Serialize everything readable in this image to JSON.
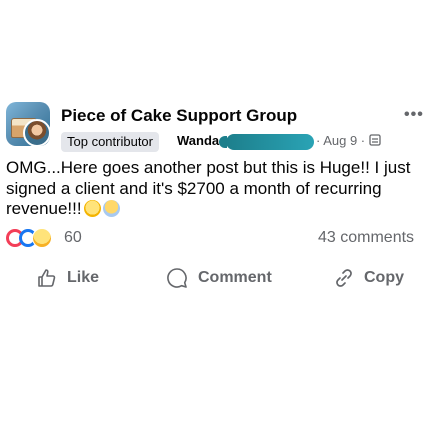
{
  "post": {
    "group_name": "Piece of Cake Support Group",
    "badge": "Top contributor",
    "author": "Wanda",
    "date": "· Aug 9 · ",
    "body": "OMG...Here goes another post but this is Huge!! I just signed a client and it's $2700 a month of recurring revenue!!!",
    "reaction_count": "60",
    "comment_count": "43 comments"
  },
  "actions": {
    "like": "Like",
    "comment": "Comment",
    "copy": "Copy"
  },
  "icons": {
    "more": "more-options-icon",
    "privacy": "group-privacy-icon",
    "reactions": [
      "love-reaction",
      "like-reaction",
      "wow-reaction"
    ]
  },
  "colors": {
    "accent": "#1877f2",
    "love": "#f33e58",
    "secondary_text": "#65676b"
  }
}
